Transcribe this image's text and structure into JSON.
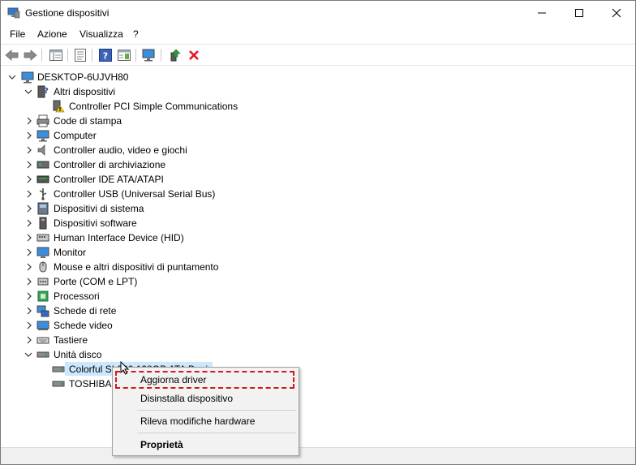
{
  "window": {
    "title": "Gestione dispositivi"
  },
  "menu": [
    "File",
    "Azione",
    "Visualizza",
    "?"
  ],
  "tree": {
    "root": "DESKTOP-6UJVH80",
    "other_devices": {
      "label": "Altri dispositivi",
      "child": "Controller PCI Simple Communications"
    },
    "categories": [
      "Code di stampa",
      "Computer",
      "Controller audio, video e giochi",
      "Controller di archiviazione",
      "Controller IDE ATA/ATAPI",
      "Controller USB (Universal Serial Bus)",
      "Dispositivi di sistema",
      "Dispositivi software",
      "Human Interface Device (HID)",
      "Monitor",
      "Mouse e altri dispositivi di puntamento",
      "Porte (COM e LPT)",
      "Processori",
      "Schede di rete",
      "Schede video",
      "Tastiere"
    ],
    "disk": {
      "label": "Unità disco",
      "children": [
        "Colorful SL300 128GB ATA Device",
        "TOSHIBA DT01ACA100 ATA Device"
      ]
    }
  },
  "context_menu": {
    "items": [
      "Aggiorna driver",
      "Disinstalla dispositivo",
      "Rileva modifiche hardware",
      "Proprietà"
    ]
  },
  "colors": {
    "highlight": "#cce8ff",
    "dash": "#d11a1a",
    "delete": "#e81123"
  }
}
